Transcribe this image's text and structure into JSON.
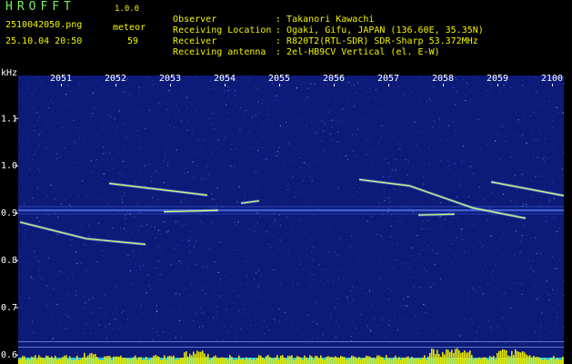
{
  "app": {
    "title": "HROFFT",
    "version": "1.0.0"
  },
  "file": {
    "name": "2510042050.png",
    "datetime": "25.10.04 20:50"
  },
  "meteor": {
    "label": "meteor",
    "count": "59"
  },
  "info": [
    {
      "key": "Observer",
      "value": "Takanori Kawachi"
    },
    {
      "key": "Receiving Location",
      "value": "Ogaki, Gifu, JAPAN (136.60E, 35.35N)"
    },
    {
      "key": "Receiver",
      "value": "R820T2(RTL-SDR) SDR-Sharp 53.372MHz"
    },
    {
      "key": "Receiving antenna",
      "value": "2el-HB9CV Vertical (el. E-W)"
    }
  ],
  "chart_data": {
    "type": "heatmap",
    "ylabel": "kHz",
    "x": [
      "2051",
      "2052",
      "2053",
      "2054",
      "2055",
      "2056",
      "2057",
      "2058",
      "2059",
      "2100"
    ],
    "y_ticks": [
      "1.1",
      "1.0",
      "0.9",
      "0.8",
      "0.7",
      "0.6"
    ],
    "ylim": [
      0.58,
      1.19
    ],
    "grid": false,
    "colors": {
      "background": "#0c1a78",
      "noise": "#3048c8",
      "signal": "#d8ff70",
      "level_bar": "#e6e600",
      "level_base": "#20c8ff"
    }
  }
}
